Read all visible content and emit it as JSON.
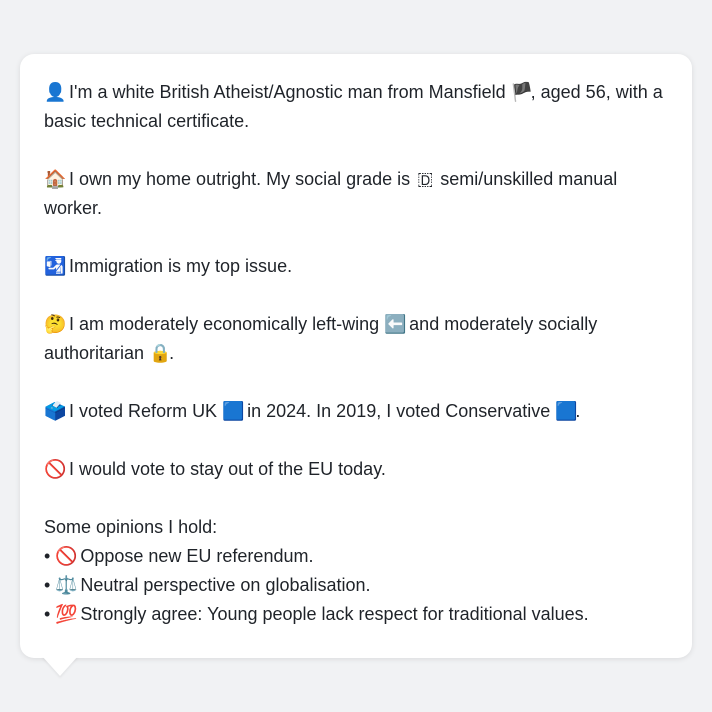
{
  "message": {
    "profile": {
      "icon": "👤",
      "text_before_flag": "I'm a white British Atheist/Agnostic man from Mansfield",
      "flag": "🏴",
      "text_after_flag": ", aged 56, with a basic technical certificate."
    },
    "home": {
      "icon": "🏠",
      "text_before_badge": "I own my home outright. My social grade is",
      "badge": "🇩",
      "text_after_badge": "semi/unskilled manual worker."
    },
    "top_issue": {
      "icon": "🛂",
      "text": "Immigration is my top issue."
    },
    "ideology": {
      "icon": "🤔",
      "text_before_left": "I am moderately economically left-wing",
      "left_icon": "⬅️",
      "text_middle": "and moderately socially authoritarian",
      "lock_icon": "🔒",
      "text_end": "."
    },
    "vote": {
      "icon": "🗳️",
      "text_before_first": "I voted Reform UK",
      "first_square": "🟦",
      "text_middle": "in 2024. In 2019, I voted Conservative",
      "second_square": "🟦",
      "text_end": "."
    },
    "eu": {
      "icon": "🚫",
      "text": "I would vote to stay out of the EU today."
    },
    "opinions_heading": "Some opinions I hold:",
    "opinions": [
      {
        "bullet": "•",
        "icon": "🚫",
        "text": "Oppose new EU referendum."
      },
      {
        "bullet": "•",
        "icon": "⚖️",
        "text": "Neutral perspective on globalisation."
      },
      {
        "bullet": "•",
        "icon": "💯",
        "text": "Strongly agree: Young people lack respect for traditional values."
      }
    ]
  }
}
